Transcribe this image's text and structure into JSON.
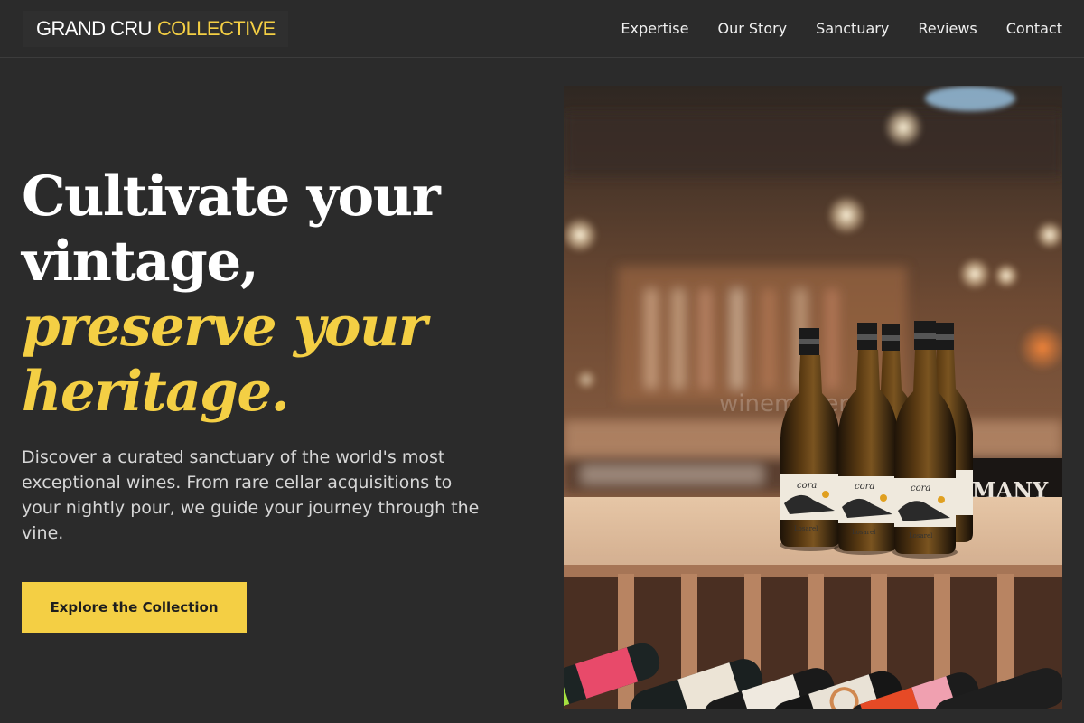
{
  "brand": {
    "name_primary": "GRAND CRU",
    "name_accent": "COLLECTIVE"
  },
  "nav": {
    "items": [
      "Expertise",
      "Our Story",
      "Sanctuary",
      "Reviews",
      "Contact"
    ]
  },
  "hero": {
    "headline_line1": "Cultivate your",
    "headline_line2": "vintage,",
    "headline_accent_line1": "preserve your",
    "headline_accent_line2": "heritage.",
    "description": "Discover a curated sanctuary of the world's most exceptional wines. From rare cellar acquisitions to your nightly pour, we guide your journey through the vine.",
    "cta_label": "Explore the Collection"
  },
  "image": {
    "watermark": "winemakers.site",
    "bottle_label_text": "cora",
    "bottle_maker_text": "Losarel",
    "sign_text": "MANY"
  },
  "colors": {
    "background": "#2b2b2b",
    "accent": "#f4cf44",
    "text": "#ffffff"
  }
}
